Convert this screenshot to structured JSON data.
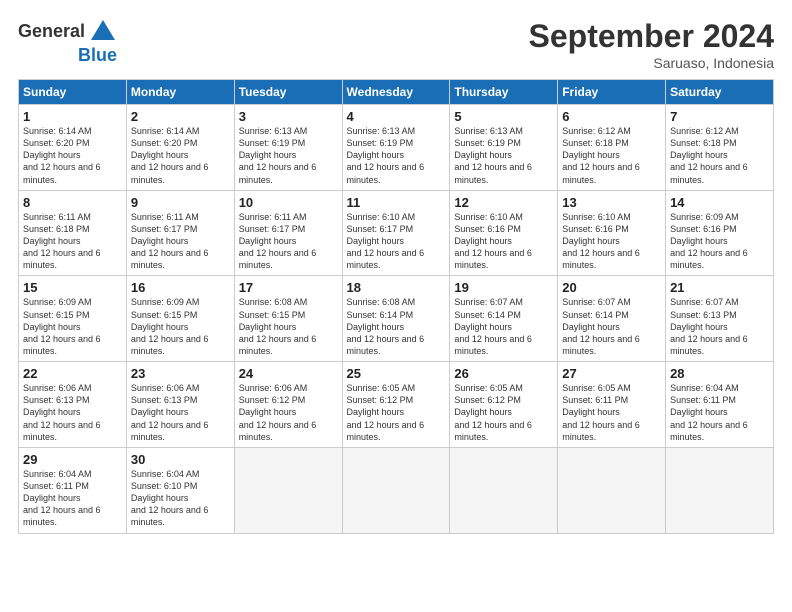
{
  "logo": {
    "line1": "General",
    "line2": "Blue"
  },
  "title": "September 2024",
  "subtitle": "Saruaso, Indonesia",
  "headers": [
    "Sunday",
    "Monday",
    "Tuesday",
    "Wednesday",
    "Thursday",
    "Friday",
    "Saturday"
  ],
  "weeks": [
    [
      {
        "day": "1",
        "rise": "6:14 AM",
        "set": "6:20 PM",
        "daylight": "12 hours and 6 minutes."
      },
      {
        "day": "2",
        "rise": "6:14 AM",
        "set": "6:20 PM",
        "daylight": "12 hours and 6 minutes."
      },
      {
        "day": "3",
        "rise": "6:13 AM",
        "set": "6:19 PM",
        "daylight": "12 hours and 6 minutes."
      },
      {
        "day": "4",
        "rise": "6:13 AM",
        "set": "6:19 PM",
        "daylight": "12 hours and 6 minutes."
      },
      {
        "day": "5",
        "rise": "6:13 AM",
        "set": "6:19 PM",
        "daylight": "12 hours and 6 minutes."
      },
      {
        "day": "6",
        "rise": "6:12 AM",
        "set": "6:18 PM",
        "daylight": "12 hours and 6 minutes."
      },
      {
        "day": "7",
        "rise": "6:12 AM",
        "set": "6:18 PM",
        "daylight": "12 hours and 6 minutes."
      }
    ],
    [
      {
        "day": "8",
        "rise": "6:11 AM",
        "set": "6:18 PM",
        "daylight": "12 hours and 6 minutes."
      },
      {
        "day": "9",
        "rise": "6:11 AM",
        "set": "6:17 PM",
        "daylight": "12 hours and 6 minutes."
      },
      {
        "day": "10",
        "rise": "6:11 AM",
        "set": "6:17 PM",
        "daylight": "12 hours and 6 minutes."
      },
      {
        "day": "11",
        "rise": "6:10 AM",
        "set": "6:17 PM",
        "daylight": "12 hours and 6 minutes."
      },
      {
        "day": "12",
        "rise": "6:10 AM",
        "set": "6:16 PM",
        "daylight": "12 hours and 6 minutes."
      },
      {
        "day": "13",
        "rise": "6:10 AM",
        "set": "6:16 PM",
        "daylight": "12 hours and 6 minutes."
      },
      {
        "day": "14",
        "rise": "6:09 AM",
        "set": "6:16 PM",
        "daylight": "12 hours and 6 minutes."
      }
    ],
    [
      {
        "day": "15",
        "rise": "6:09 AM",
        "set": "6:15 PM",
        "daylight": "12 hours and 6 minutes."
      },
      {
        "day": "16",
        "rise": "6:09 AM",
        "set": "6:15 PM",
        "daylight": "12 hours and 6 minutes."
      },
      {
        "day": "17",
        "rise": "6:08 AM",
        "set": "6:15 PM",
        "daylight": "12 hours and 6 minutes."
      },
      {
        "day": "18",
        "rise": "6:08 AM",
        "set": "6:14 PM",
        "daylight": "12 hours and 6 minutes."
      },
      {
        "day": "19",
        "rise": "6:07 AM",
        "set": "6:14 PM",
        "daylight": "12 hours and 6 minutes."
      },
      {
        "day": "20",
        "rise": "6:07 AM",
        "set": "6:14 PM",
        "daylight": "12 hours and 6 minutes."
      },
      {
        "day": "21",
        "rise": "6:07 AM",
        "set": "6:13 PM",
        "daylight": "12 hours and 6 minutes."
      }
    ],
    [
      {
        "day": "22",
        "rise": "6:06 AM",
        "set": "6:13 PM",
        "daylight": "12 hours and 6 minutes."
      },
      {
        "day": "23",
        "rise": "6:06 AM",
        "set": "6:13 PM",
        "daylight": "12 hours and 6 minutes."
      },
      {
        "day": "24",
        "rise": "6:06 AM",
        "set": "6:12 PM",
        "daylight": "12 hours and 6 minutes."
      },
      {
        "day": "25",
        "rise": "6:05 AM",
        "set": "6:12 PM",
        "daylight": "12 hours and 6 minutes."
      },
      {
        "day": "26",
        "rise": "6:05 AM",
        "set": "6:12 PM",
        "daylight": "12 hours and 6 minutes."
      },
      {
        "day": "27",
        "rise": "6:05 AM",
        "set": "6:11 PM",
        "daylight": "12 hours and 6 minutes."
      },
      {
        "day": "28",
        "rise": "6:04 AM",
        "set": "6:11 PM",
        "daylight": "12 hours and 6 minutes."
      }
    ],
    [
      {
        "day": "29",
        "rise": "6:04 AM",
        "set": "6:11 PM",
        "daylight": "12 hours and 6 minutes."
      },
      {
        "day": "30",
        "rise": "6:04 AM",
        "set": "6:10 PM",
        "daylight": "12 hours and 6 minutes."
      },
      null,
      null,
      null,
      null,
      null
    ]
  ]
}
